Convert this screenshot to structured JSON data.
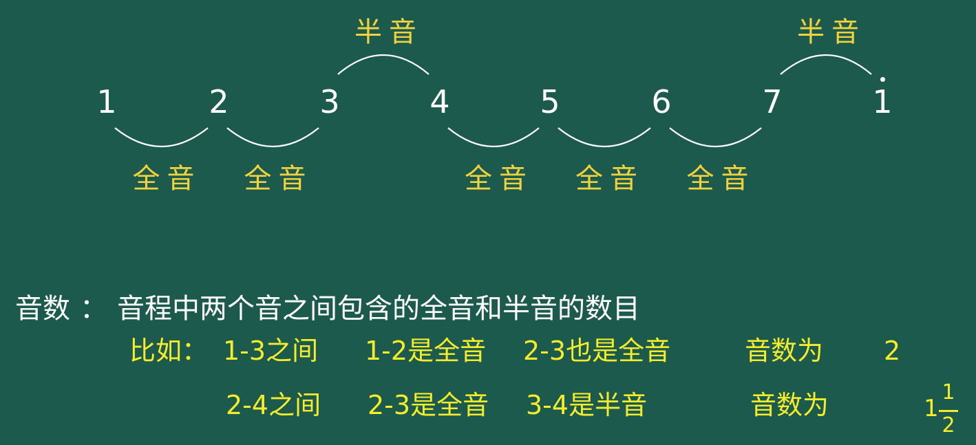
{
  "scale": {
    "notes": [
      "1",
      "2",
      "3",
      "4",
      "5",
      "6",
      "7",
      "1"
    ],
    "high_dot_on_last_note": true
  },
  "intervals": [
    {
      "from": "1",
      "to": "2",
      "label": "全音"
    },
    {
      "from": "2",
      "to": "3",
      "label": "全音"
    },
    {
      "from": "3",
      "to": "4",
      "label": "半音"
    },
    {
      "from": "4",
      "to": "5",
      "label": "全音"
    },
    {
      "from": "5",
      "to": "6",
      "label": "全音"
    },
    {
      "from": "6",
      "to": "7",
      "label": "全音"
    },
    {
      "from": "7",
      "to": "1",
      "label": "半音"
    }
  ],
  "definition": {
    "term": "音数",
    "colon": "：",
    "text": "音程中两个音之间包含的全音和半音的数目"
  },
  "examples": [
    {
      "lead": "比如：",
      "range": "1-3之间",
      "step1": "1-2是全音",
      "step2": "2-3也是全音",
      "result_label": "音数为",
      "result_value": "2"
    },
    {
      "lead": "",
      "range": "2-4之间",
      "step1": "2-3是全音",
      "step2": "3-4是半音",
      "result_label": "音数为",
      "result_whole": "1",
      "result_numerator": "1",
      "result_denominator": "2"
    }
  ],
  "colors": {
    "background": "#1d5a4e",
    "note": "#ffffff",
    "arc": "#ffffff",
    "interval_label": "#f3d33c",
    "definition": "#ffffff",
    "example": "#f5ec2a"
  }
}
